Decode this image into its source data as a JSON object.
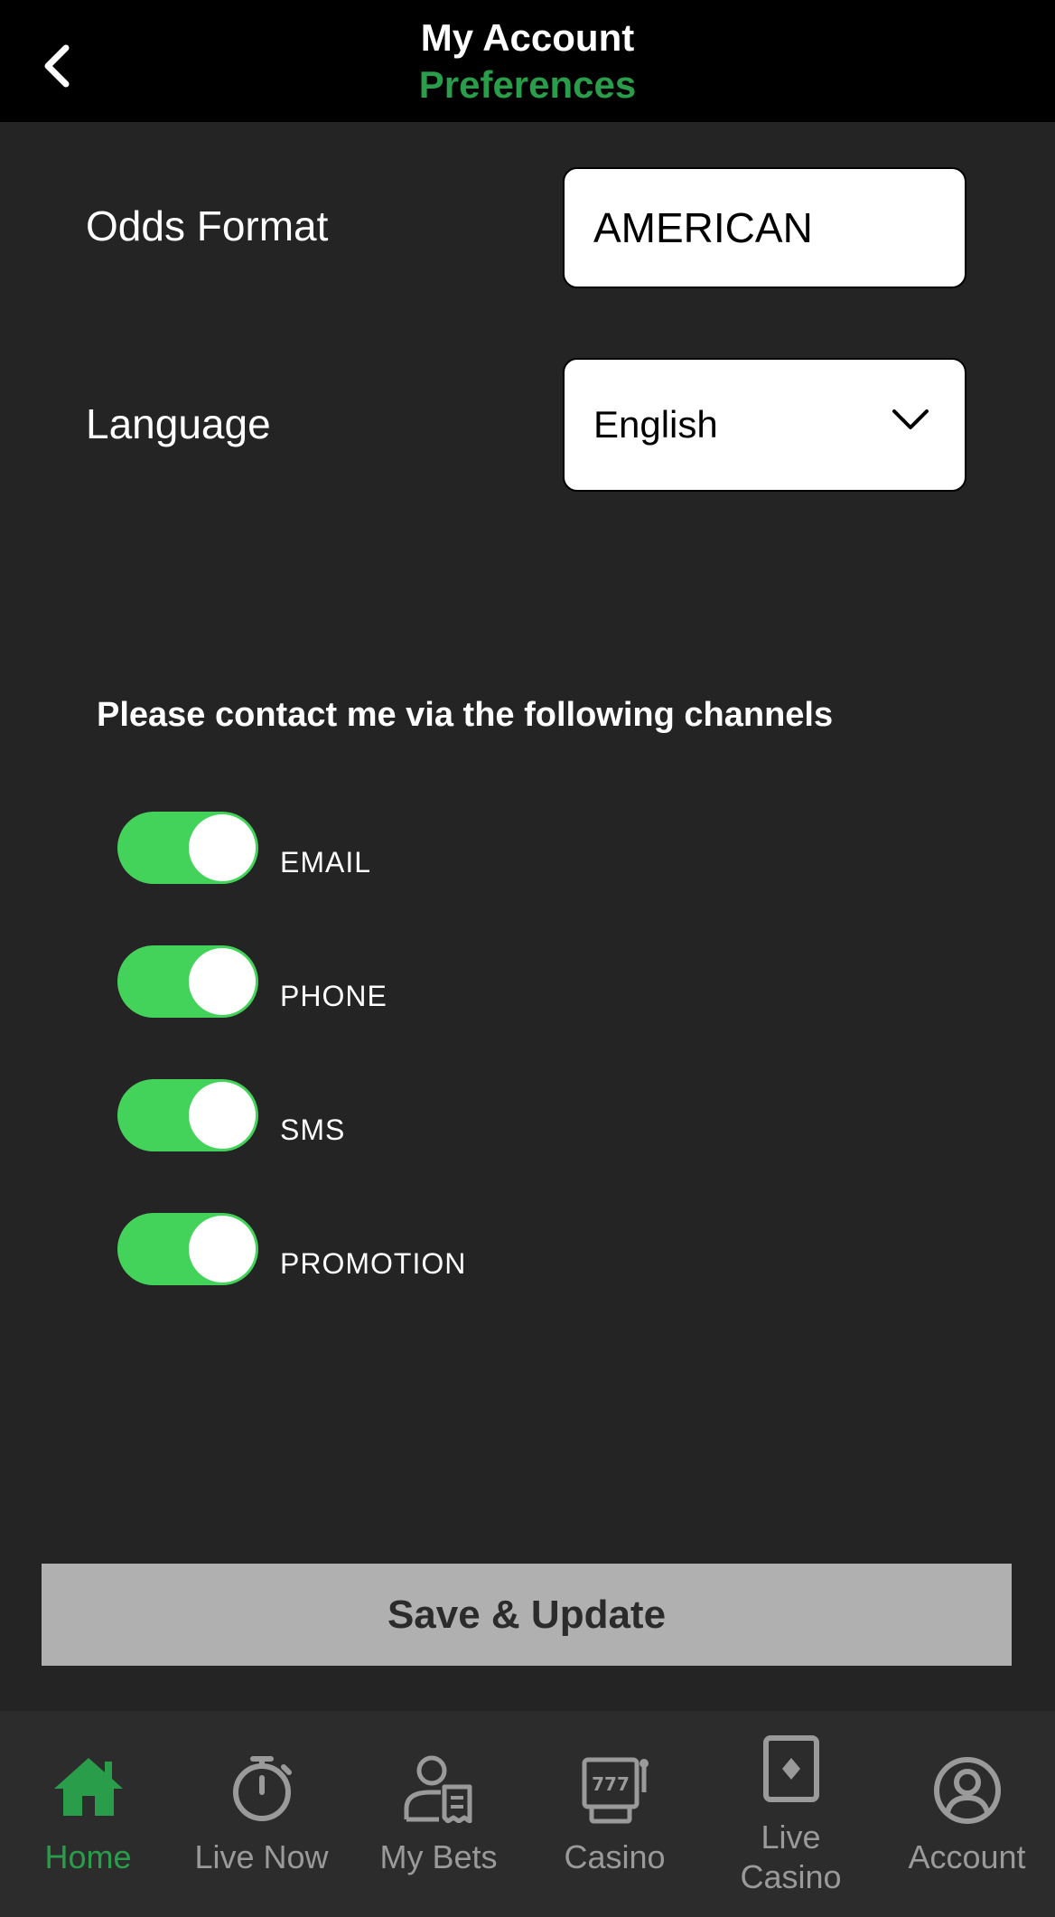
{
  "header": {
    "title": "My Account",
    "subtitle": "Preferences",
    "back_icon": "chevron-left-icon"
  },
  "preferences": {
    "odds_format_label": "Odds Format",
    "odds_format_value": "AMERICAN",
    "language_label": "Language",
    "language_value": "English"
  },
  "contact": {
    "heading": "Please contact me via the following channels",
    "channels": [
      {
        "label": "EMAIL",
        "enabled": true
      },
      {
        "label": "PHONE",
        "enabled": true
      },
      {
        "label": "SMS",
        "enabled": true
      },
      {
        "label": "PROMOTION",
        "enabled": true
      }
    ]
  },
  "save_label": "Save & Update",
  "nav": {
    "items": [
      {
        "label": "Home",
        "icon": "home-icon",
        "active": true
      },
      {
        "label": "Live Now",
        "icon": "stopwatch-icon",
        "active": false
      },
      {
        "label": "My Bets",
        "icon": "user-receipt-icon",
        "active": false
      },
      {
        "label": "Casino",
        "icon": "slot-machine-icon",
        "active": false
      },
      {
        "label": "Live Casino",
        "icon": "playing-card-icon",
        "active": false
      },
      {
        "label": "Account",
        "icon": "user-circle-icon",
        "active": false
      }
    ]
  },
  "colors": {
    "accent_green": "#2a9d4b",
    "toggle_green": "#44d35a",
    "background": "#242424",
    "header_bg": "#000000",
    "save_button_bg": "#b0b0b0",
    "nav_inactive": "#9a9a9a"
  }
}
